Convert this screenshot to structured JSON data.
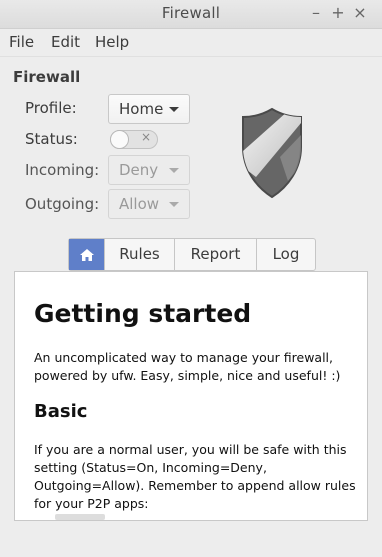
{
  "window": {
    "title": "Firewall",
    "controls": [
      "minimize",
      "maximize",
      "close"
    ]
  },
  "menu": {
    "file": "File",
    "edit": "Edit",
    "help": "Help"
  },
  "header": {
    "title": "Firewall"
  },
  "settings": {
    "profile_label": "Profile:",
    "profile_value": "Home",
    "status_label": "Status:",
    "status_on": false,
    "incoming_label": "Incoming:",
    "incoming_value": "Deny",
    "outgoing_label": "Outgoing:",
    "outgoing_value": "Allow"
  },
  "tabs": [
    {
      "label": "",
      "icon": "home-icon",
      "active": true
    },
    {
      "label": "Rules",
      "active": false
    },
    {
      "label": "Report",
      "active": false
    },
    {
      "label": "Log",
      "active": false
    }
  ],
  "content": {
    "heading": "Getting started",
    "intro": "An uncomplicated way to manage your firewall, powered by ufw. Easy, simple, nice and useful! :)",
    "subheading": "Basic",
    "basic_text": "If you are a normal user, you will be safe with this setting (Status=On, Incoming=Deny, Outgoing=Allow). Remember to append allow rules for your P2P apps:"
  },
  "colors": {
    "active_tab": "#5f7fc9",
    "background": "#ededed"
  }
}
